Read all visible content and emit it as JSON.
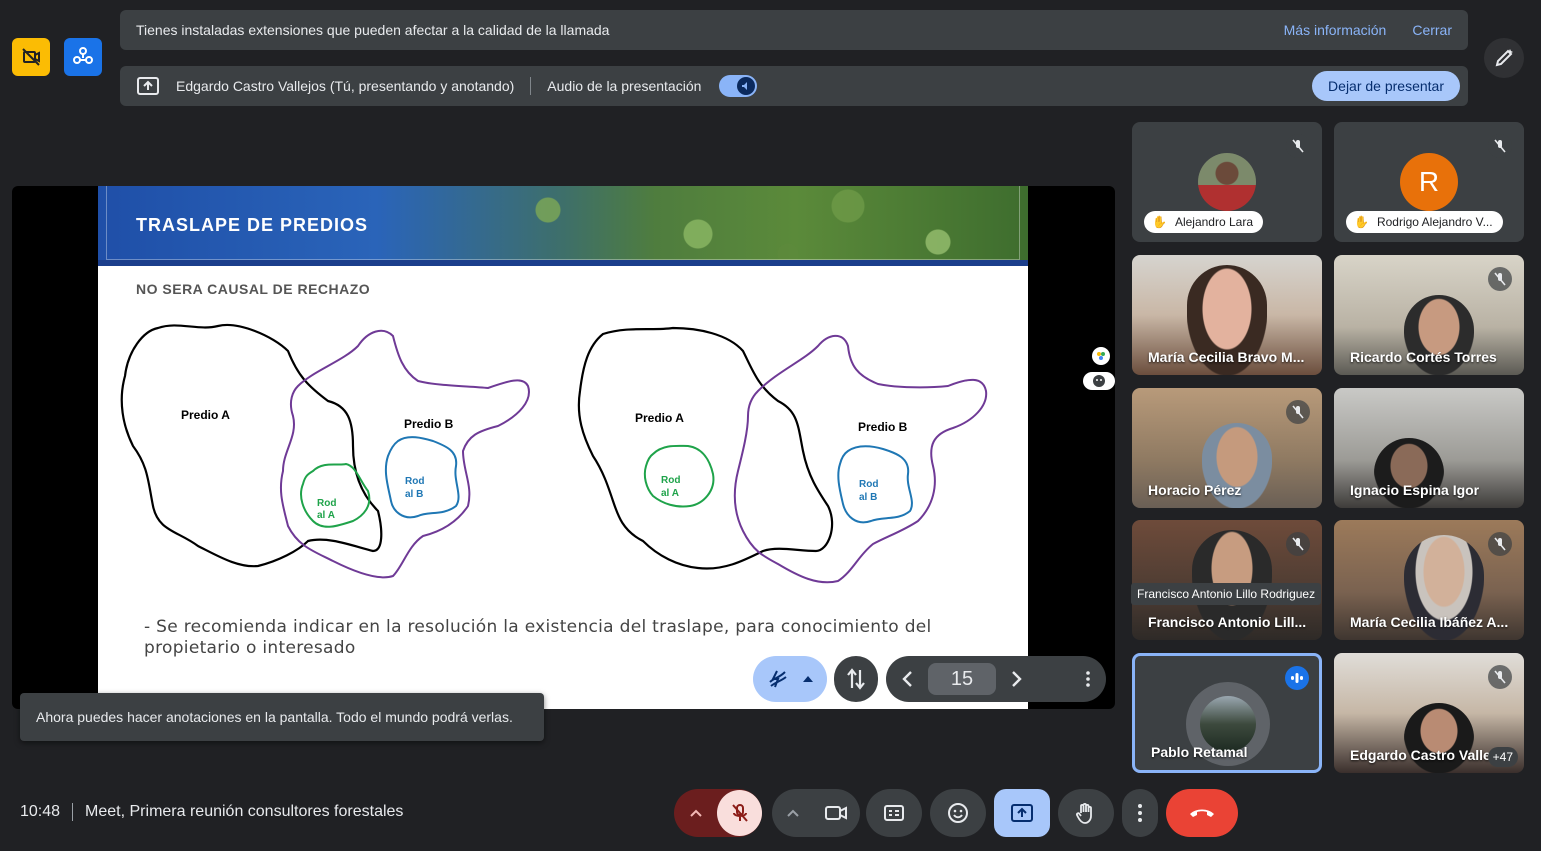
{
  "banner": {
    "message": "Tienes instaladas extensiones que pueden afectar a la calidad de la llamada",
    "more_info": "Más información",
    "close": "Cerrar"
  },
  "presenting": {
    "text": "Edgardo Castro Vallejos (Tú, presentando y anotando)",
    "audio_label": "Audio de la presentación",
    "stop_button": "Dejar de presentar"
  },
  "slide": {
    "title": "TRASLAPE DE PREDIOS",
    "subtitle": "NO SERA CAUSAL DE RECHAZO",
    "body": "- Se recomienda indicar en la resolución la existencia del traslape, para conocimiento del propietario o interesado",
    "diagram": {
      "predio_a": "Predio A",
      "predio_b": "Predio B",
      "rod_a_line1": "Rod",
      "rod_a_line2": "al A",
      "rod_b_line1": "Rod",
      "rod_b_line2": "al B"
    }
  },
  "slide_controls": {
    "page": "15"
  },
  "toast": "Ahora puedes hacer anotaciones en la pantalla. Todo el mundo podrá verlas.",
  "participants": [
    {
      "name": "Alejandro Lara"
    },
    {
      "name": "Rodrigo Alejandro V...",
      "initial": "R"
    },
    {
      "name": "María Cecilia Bravo M..."
    },
    {
      "name": "Ricardo Cortés Torres"
    },
    {
      "name": "Horacio Pérez"
    },
    {
      "name": "Ignacio Espina Igor"
    },
    {
      "name": "Francisco Antonio Lill...",
      "tooltip": "Francisco Antonio Lillo Rodriguez"
    },
    {
      "name": "María Cecilia Ibáñez A..."
    },
    {
      "name": "Pablo Retamal"
    },
    {
      "name": "Edgardo Castro Valle",
      "more": "+47"
    }
  ],
  "bottom": {
    "time": "10:48",
    "meeting": "Meet, Primera reunión consultores forestales"
  },
  "colors": {
    "background": "#202124",
    "accent": "#8ab4f8",
    "hangup": "#ea4335",
    "mic_off": "#f9dedc"
  }
}
